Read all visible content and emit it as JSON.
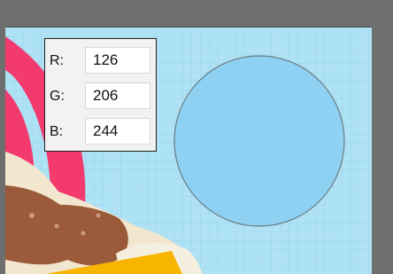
{
  "color_picker": {
    "red": {
      "label": "R:",
      "value": "126"
    },
    "green": {
      "label": "G:",
      "value": "206"
    },
    "blue": {
      "label": "B:",
      "value": "244"
    }
  },
  "colors": {
    "workspace_bg": "#6e6e6e",
    "canvas_bg": "#aee2f4",
    "grid_line": "#99d6ee",
    "sampled_circle": "#8fd1f2",
    "circle_outline": "#6a7b84",
    "pink_accent": "#f33a6f",
    "yellow_accent": "#f7b500",
    "cream": "#f2e6cf",
    "brown": "#9b5a3a"
  },
  "icons": {
    "sampled_color_swatch": "circle"
  }
}
